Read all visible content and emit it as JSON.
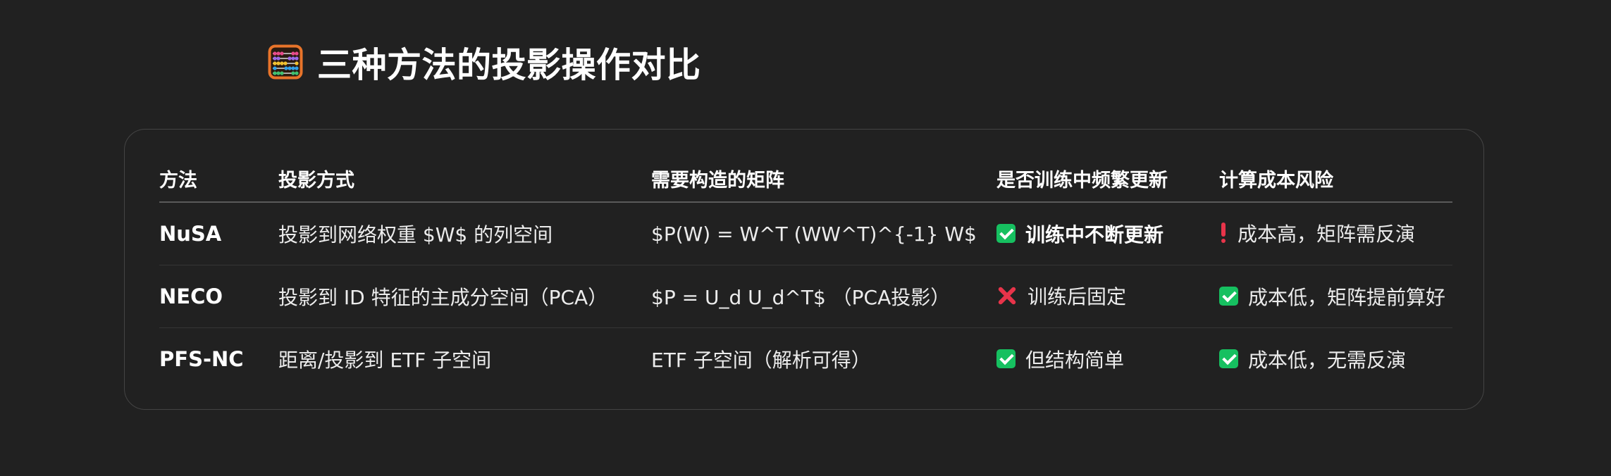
{
  "page": {
    "title": "三种方法的投影操作对比",
    "title_icon": "abacus-icon"
  },
  "table": {
    "headers": [
      "方法",
      "投影方式",
      "需要构造的矩阵",
      "是否训练中频繁更新",
      "计算成本风险"
    ],
    "rows": [
      {
        "method": "NuSA",
        "projection": "投影到网络权重 $W$ 的列空间",
        "matrix": "$P(W) = W^T (WW^T)^{-1} W$",
        "update": {
          "icon": "check-icon",
          "text": "训练中不断更新",
          "bold": true
        },
        "cost": {
          "icon": "exclamation-icon",
          "text": "成本高，矩阵需反演"
        }
      },
      {
        "method": "NECO",
        "projection": "投影到 ID 特征的主成分空间（PCA）",
        "matrix": "$P = U_d U_d^T$ （PCA投影）",
        "update": {
          "icon": "cross-icon",
          "text": "训练后固定",
          "bold": false
        },
        "cost": {
          "icon": "check-icon",
          "text": "成本低，矩阵提前算好"
        }
      },
      {
        "method": "PFS-NC",
        "projection": "距离/投影到 ETF 子空间",
        "matrix": "ETF 子空间（解析可得）",
        "update": {
          "icon": "check-icon",
          "text": "但结构简单",
          "bold": false
        },
        "cost": {
          "icon": "check-icon",
          "text": "成本低，无需反演"
        }
      }
    ]
  },
  "colors": {
    "background": "#212121",
    "check": "#16c060",
    "cross": "#e8344a",
    "border": "#444444"
  }
}
